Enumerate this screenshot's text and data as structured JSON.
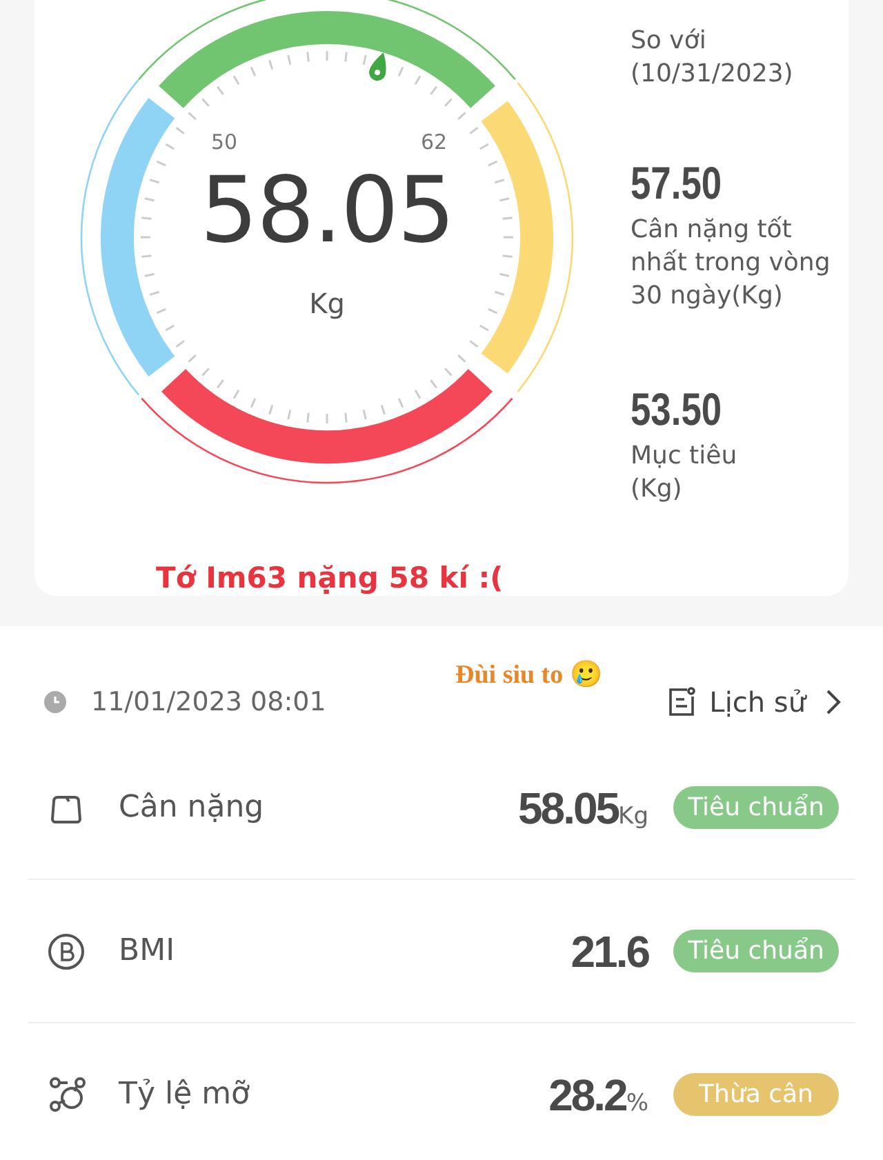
{
  "gauge": {
    "value": "58.05",
    "unit": "Kg",
    "min_label": "50",
    "max_label": "62"
  },
  "stats": [
    {
      "label_lines": [
        "So với",
        "(10/31/2023)"
      ]
    },
    {
      "value": "57.50",
      "label_lines": [
        "Cân nặng tốt",
        "nhất trong vòng",
        "30 ngày(Kg)"
      ]
    },
    {
      "value": "53.50",
      "label_lines": [
        "Mục tiêu",
        "(Kg)"
      ]
    }
  ],
  "caption": "Tớ Im63 nặng 58 kí :(",
  "note": "Đùi siu to 🥲",
  "record": {
    "time": "11/01/2023 08:01",
    "history": "Lịch sử"
  },
  "metrics": [
    {
      "kind": "weight",
      "name": "Cân nặng",
      "value": "58.05",
      "unit": "Kg",
      "status": "Tiêu chuẩn",
      "color": "#88c98a"
    },
    {
      "kind": "bmi",
      "name": "BMI",
      "value": "21.6",
      "status": "Tiêu chuẩn",
      "color": "#88c98a"
    },
    {
      "kind": "fat",
      "name": "Tỷ lệ mỡ",
      "value": "28.2",
      "unit": "%",
      "status": "Thừa cân",
      "color": "#e6c46e"
    }
  ]
}
